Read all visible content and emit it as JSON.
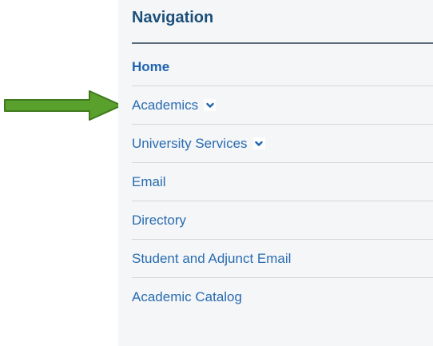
{
  "nav": {
    "title": "Navigation",
    "items": [
      {
        "label": "Home",
        "active": true,
        "has_dropdown": false
      },
      {
        "label": "Academics",
        "active": false,
        "has_dropdown": true
      },
      {
        "label": "University Services",
        "active": false,
        "has_dropdown": true
      },
      {
        "label": "Email",
        "active": false,
        "has_dropdown": false
      },
      {
        "label": "Directory",
        "active": false,
        "has_dropdown": false
      },
      {
        "label": "Student and Adjunct Email",
        "active": false,
        "has_dropdown": false
      },
      {
        "label": "Academic Catalog",
        "active": false,
        "has_dropdown": false
      }
    ]
  },
  "annotation": {
    "icon": "right-arrow-icon",
    "color": "#5aa02c",
    "outline_color": "#3f7a1e",
    "points_to": "Academics"
  },
  "colors": {
    "title": "#1b4f7a",
    "link": "#2a6cb0",
    "active_link": "#1f63b0",
    "panel_bg": "#f4f6f8",
    "chevron": "#1f63b0"
  }
}
